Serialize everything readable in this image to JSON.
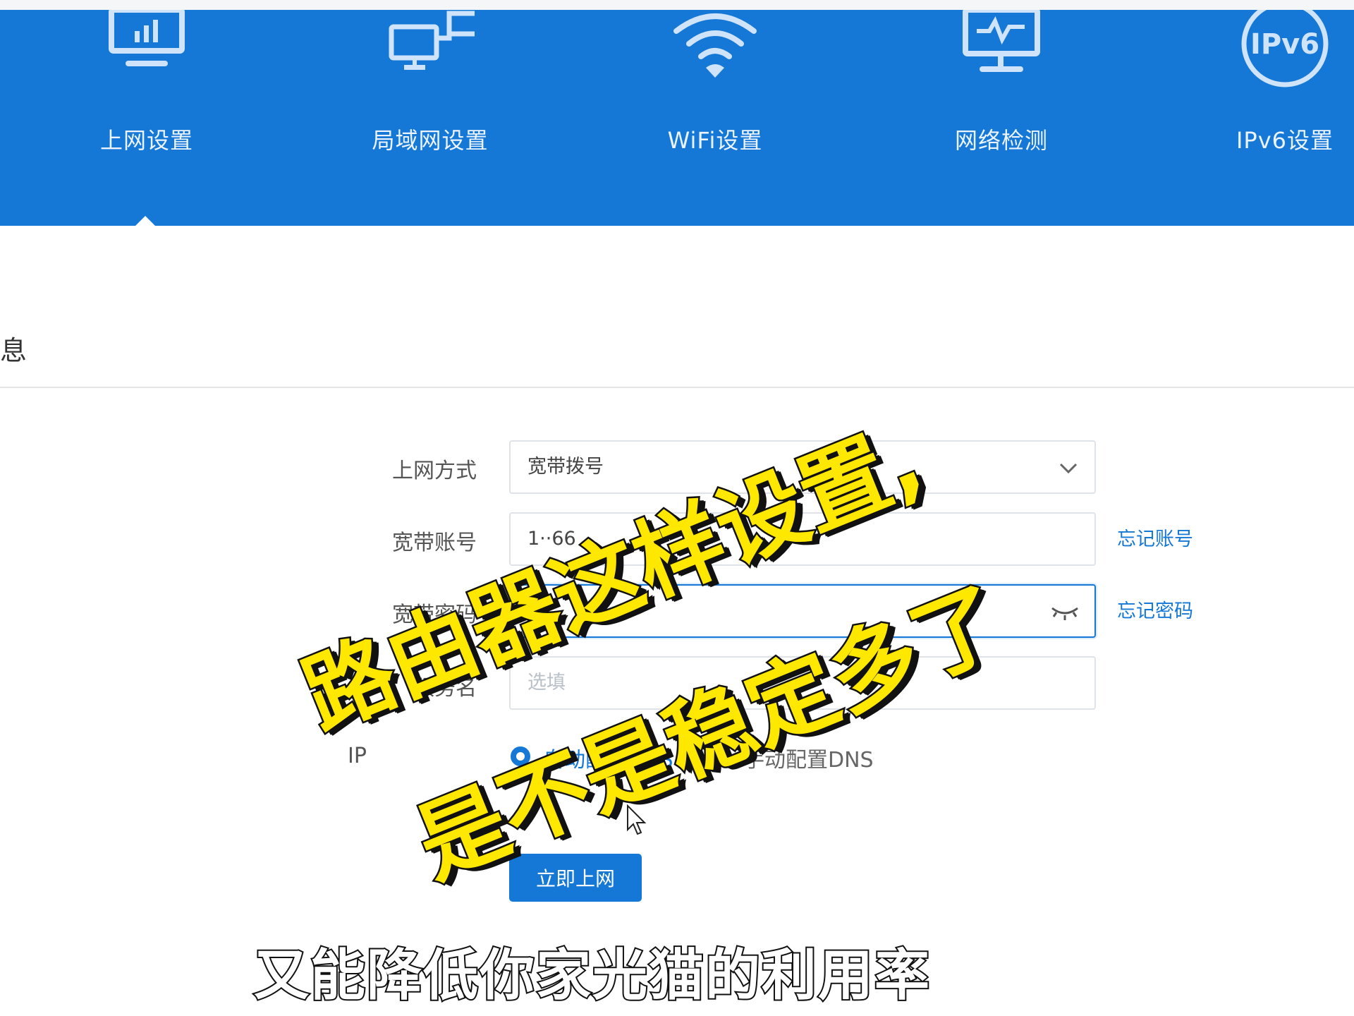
{
  "nav": {
    "items": [
      {
        "label": "上网设置",
        "icon": "monitor-chart-icon",
        "active": true
      },
      {
        "label": "局域网设置",
        "icon": "lan-network-icon",
        "active": false
      },
      {
        "label": "WiFi设置",
        "icon": "wifi-icon",
        "active": false
      },
      {
        "label": "网络检测",
        "icon": "monitor-pulse-icon",
        "active": false
      },
      {
        "label": "IPv6设置",
        "icon": "ipv6-badge-icon",
        "active": false
      }
    ],
    "ipv6_badge_text": "IPv6",
    "accent_color": "#1678d6"
  },
  "section": {
    "title_fragment": "息"
  },
  "form": {
    "mode_label": "上网方式",
    "mode_value": "宽带拨号",
    "account_label": "宽带账号",
    "account_value": "1··66",
    "forgot_account": "忘记账号",
    "password_label": "宽带密码",
    "forgot_password": "忘记密码",
    "service_label": "服务名",
    "service_placeholder": "选填",
    "dns_label": "IP",
    "dns_auto": "自动配置DNS",
    "dns_manual": "手动配置DNS",
    "submit": "立即上网"
  },
  "overlay": {
    "line1": "路由器这样设置,",
    "line2": "是不是稳定多了"
  },
  "subtitle": "又能降低你家光猫的利用率"
}
